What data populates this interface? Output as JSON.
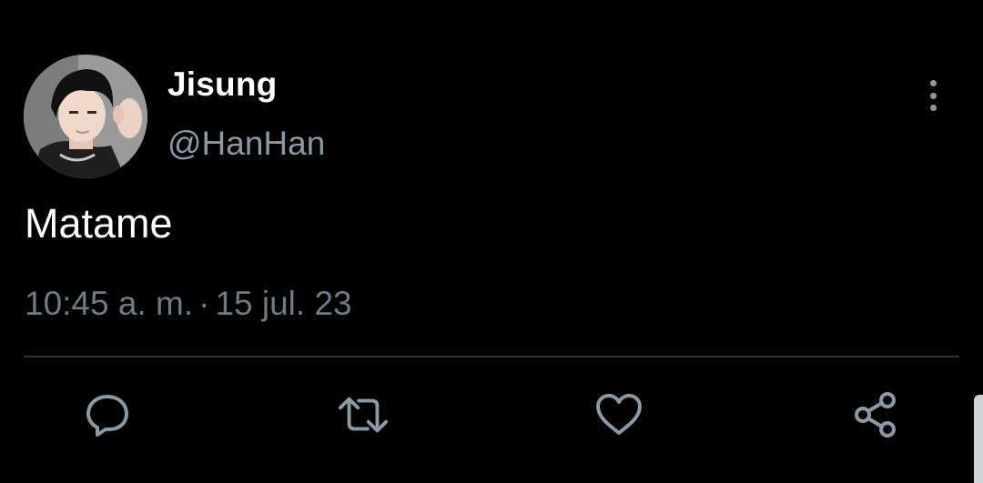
{
  "tweet": {
    "display_name": "Jisung",
    "handle": "@HanHan",
    "text": "Matame",
    "time": "10:45 a. m.",
    "separator": "·",
    "date": "15 jul. 23"
  },
  "actions": {
    "reply_icon": "reply-icon",
    "retweet_icon": "retweet-icon",
    "like_icon": "heart-icon",
    "share_icon": "share-icon",
    "more_icon": "more-vertical-icon"
  },
  "colors": {
    "background": "#000000",
    "primary_text": "#ffffff",
    "secondary_text": "#8b98a5",
    "divider": "#2f3336"
  }
}
